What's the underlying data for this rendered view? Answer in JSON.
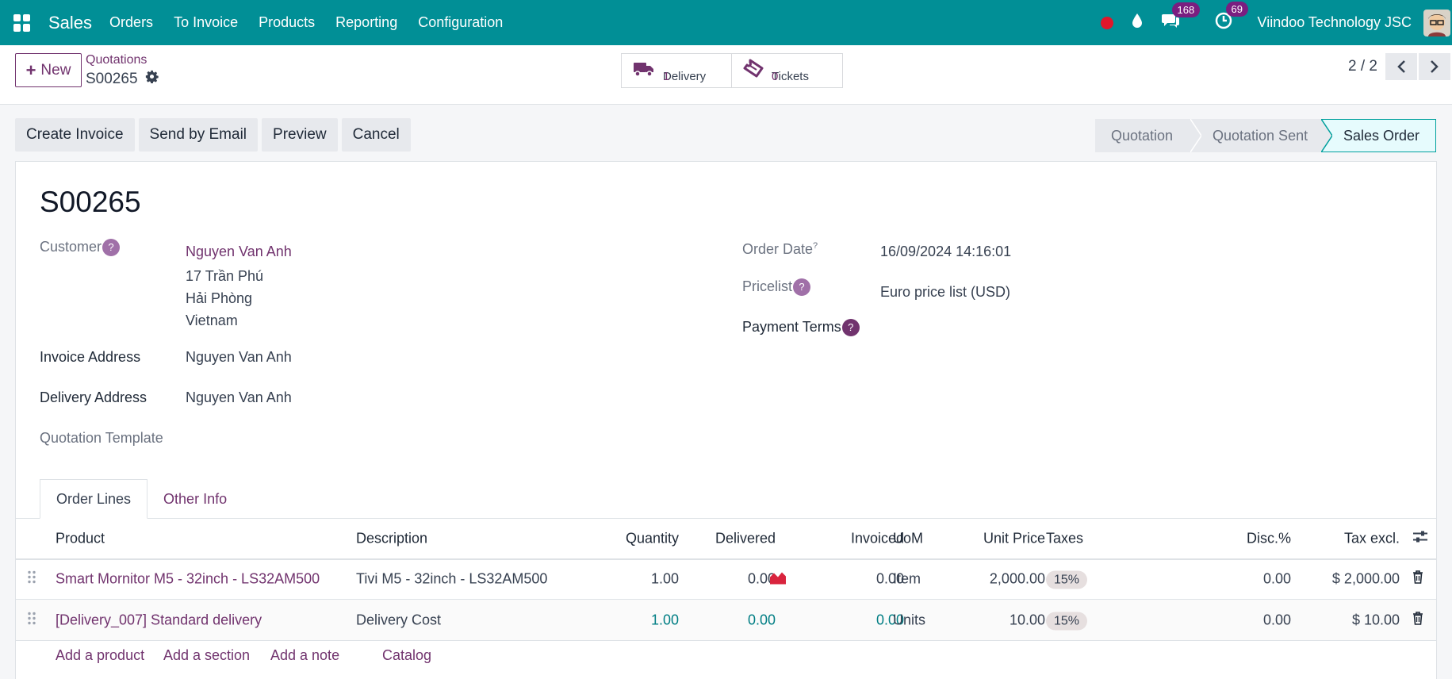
{
  "nav": {
    "app": "Sales",
    "menu": [
      "Orders",
      "To Invoice",
      "Products",
      "Reporting",
      "Configuration"
    ],
    "messages_count": "168",
    "activities_count": "69",
    "company": "Viindoo Technology JSC"
  },
  "control": {
    "new_label": "New",
    "breadcrumb": "Quotations",
    "record": "S00265",
    "delivery_label": "Delivery",
    "delivery_count": "1",
    "tickets_label": "Tickets",
    "tickets_count": "0",
    "pager": "2 / 2"
  },
  "actions": [
    "Create Invoice",
    "Send by Email",
    "Preview",
    "Cancel"
  ],
  "statusbar": [
    "Quotation",
    "Quotation Sent",
    "Sales Order"
  ],
  "form": {
    "title": "S00265",
    "customer_label": "Customer",
    "customer_name": "Nguyen Van Anh",
    "addr1": "17 Trần Phú",
    "addr2": "Hải Phòng",
    "addr3": "Vietnam",
    "invoice_label": "Invoice Address",
    "invoice_value": "Nguyen Van Anh",
    "delivery_label": "Delivery Address",
    "delivery_value": "Nguyen Van Anh",
    "template_label": "Quotation Template",
    "order_date_label": "Order Date",
    "order_date_value": "16/09/2024 14:16:01",
    "pricelist_label": "Pricelist",
    "pricelist_value": "Euro price list (USD)",
    "payment_label": "Payment Terms",
    "help_mark": "?"
  },
  "tabs": [
    "Order Lines",
    "Other Info"
  ],
  "table": {
    "headers": [
      "Product",
      "Description",
      "Quantity",
      "Delivered",
      "Invoiced",
      "UoM",
      "Unit Price",
      "Taxes",
      "Disc.%",
      "Tax excl."
    ],
    "rows": [
      {
        "product": "Smart Mornitor M5 - 32inch - LS32AM500",
        "description": "Tivi M5 - 32inch - LS32AM500",
        "qty": "1.00",
        "delivered": "0.00",
        "invoiced": "0.00",
        "uom": "Item",
        "price": "2,000.00",
        "tax": "15%",
        "disc": "0.00",
        "subtotal": "$ 2,000.00"
      },
      {
        "product": "[Delivery_007] Standard delivery",
        "description": "Delivery Cost",
        "qty": "1.00",
        "delivered": "0.00",
        "invoiced": "0.00",
        "uom": "Units",
        "price": "10.00",
        "tax": "15%",
        "disc": "0.00",
        "subtotal": "$ 10.00"
      }
    ],
    "footer": [
      "Add a product",
      "Add a section",
      "Add a note",
      "Catalog"
    ]
  }
}
